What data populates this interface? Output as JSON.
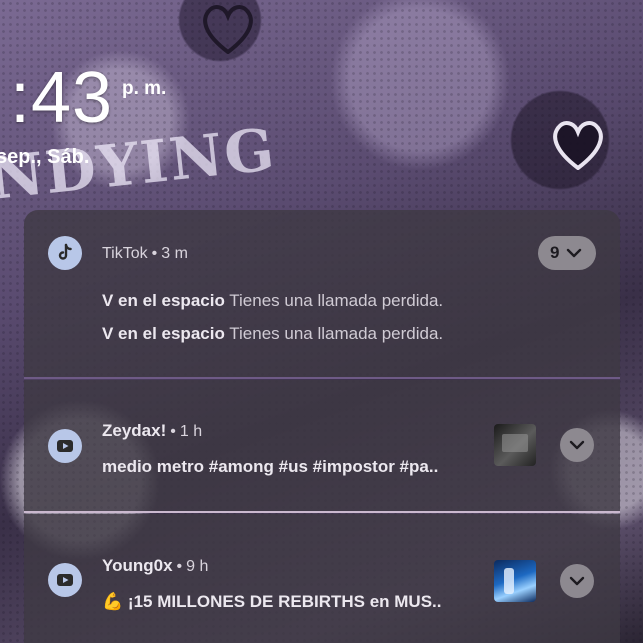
{
  "lockscreen": {
    "time": ":43",
    "ampm": "p. m.",
    "date": "sep., Sáb.",
    "wallpaper_text": "NDYING"
  },
  "notifications": [
    {
      "app": "TikTok",
      "time": "3 m",
      "count": "9",
      "messages": [
        {
          "sender": "V en el espacio",
          "text": "Tienes una llamada perdida."
        },
        {
          "sender": "V en el espacio",
          "text": "Tienes una llamada perdida."
        }
      ],
      "icon": "tiktok-icon"
    },
    {
      "app": "Zeydax!",
      "time": "1 h",
      "text": "medio metro #among #us #impostor #pa..",
      "icon": "youtube-icon"
    },
    {
      "app": "Young0x",
      "time": "9 h",
      "emoji": "💪",
      "text": "¡15 MILLONES DE REBIRTHS en MUS..",
      "icon": "youtube-icon"
    }
  ],
  "colors": {
    "card_bg": "#3e3a44",
    "icon_bg": "#b8c7e8",
    "pill_bg": "#8d8990",
    "divider_1": "#6e5a86",
    "divider_2": "#cbb9cf"
  }
}
